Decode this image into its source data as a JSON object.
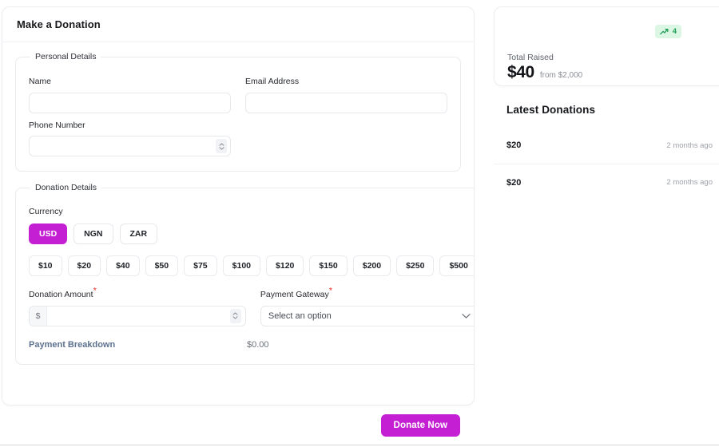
{
  "main": {
    "title": "Make a Donation",
    "personal": {
      "legend": "Personal Details",
      "name_label": "Name",
      "name_value": "",
      "name_placeholder": "",
      "email_label": "Email Address",
      "email_value": "",
      "email_placeholder": "",
      "phone_label": "Phone Number",
      "phone_value": "",
      "phone_placeholder": ""
    },
    "donation": {
      "legend": "Donation Details",
      "currency_label": "Currency",
      "currencies": [
        {
          "code": "USD",
          "active": true
        },
        {
          "code": "NGN",
          "active": false
        },
        {
          "code": "ZAR",
          "active": false
        }
      ],
      "presets": [
        "$10",
        "$20",
        "$40",
        "$50",
        "$75",
        "$100",
        "$120",
        "$150",
        "$200",
        "$250",
        "$500"
      ],
      "amount_label": "Donation Amount",
      "amount_required": "*",
      "amount_prefix": "$",
      "amount_value": "",
      "amount_placeholder": "",
      "gateway_label": "Payment Gateway",
      "gateway_required": "*",
      "gateway_selected": "Select an option",
      "breakdown_link": "Payment Breakdown",
      "breakdown_value": "$0.00"
    },
    "submit_label": "Donate Now"
  },
  "sidebar": {
    "stat": {
      "trend_icon": "trending-up-icon",
      "trend_count": "4",
      "label": "Total Raised",
      "value": "$40",
      "goal": "from $2,000"
    },
    "latest": {
      "title": "Latest Donations",
      "rows": [
        {
          "amount": "$20",
          "time": "2 months ago"
        },
        {
          "amount": "$20",
          "time": "2 months ago"
        }
      ]
    }
  },
  "colors": {
    "accent": "#c41fd3",
    "required": "#e8372c",
    "link": "#5d7290",
    "trend": "#1f9d55",
    "trend_bg": "#dcf6e4"
  }
}
